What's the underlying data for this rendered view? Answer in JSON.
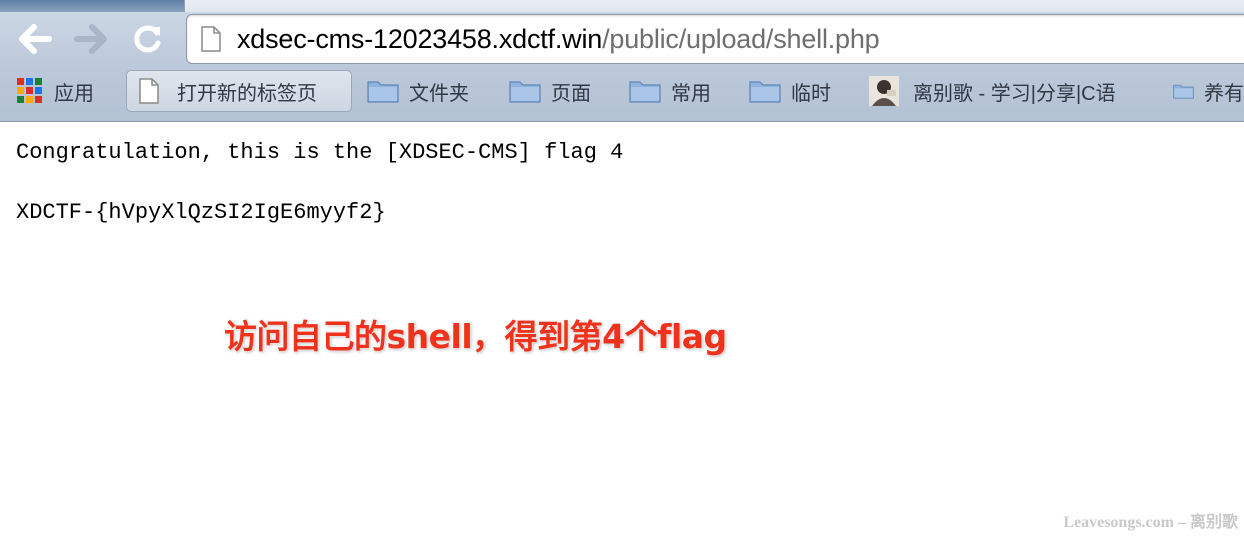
{
  "browser": {
    "url_host": "xdsec-cms-12023458.xdctf.win",
    "url_path": "/public/upload/shell.php",
    "bookmarks": [
      {
        "label": "应用",
        "icon": "apps-grid-icon"
      },
      {
        "label": "打开新的标签页",
        "icon": "page-icon"
      },
      {
        "label": "文件夹",
        "icon": "folder-icon"
      },
      {
        "label": "页面",
        "icon": "folder-icon"
      },
      {
        "label": "常用",
        "icon": "folder-icon"
      },
      {
        "label": "临时",
        "icon": "folder-icon"
      },
      {
        "label": "离别歌 - 学习|分享|C语",
        "icon": "site-favicon"
      },
      {
        "label": "养有",
        "icon": "folder-icon"
      }
    ]
  },
  "page": {
    "line1": "Congratulation, this is the [XDSEC-CMS] flag 4",
    "line2": "XDCTF-{hVpyXlQzSI2IgE6myyf2}"
  },
  "annotation": "访问自己的shell，得到第4个flag",
  "watermark": "Leavesongs.com – 离别歌",
  "colors": {
    "annotation": "#f0321c",
    "toolbar": "#bcc9da"
  }
}
